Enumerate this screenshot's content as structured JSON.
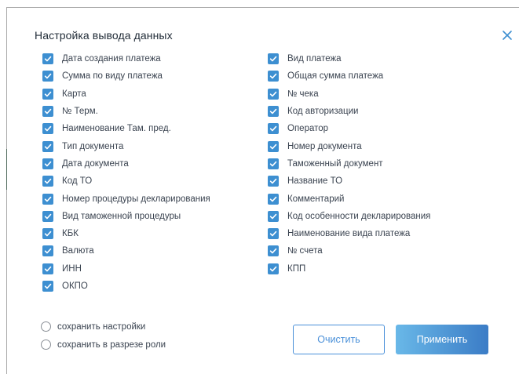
{
  "dialog": {
    "title": "Настройка вывода данных"
  },
  "colors": {
    "checkbox": "#3d8fd1",
    "accent": "#4a90d9",
    "apply_gradient_start": "#69b8e8",
    "apply_gradient_end": "#3b7cc6"
  },
  "left_options": [
    {
      "label": "Дата создания платежа",
      "checked": true
    },
    {
      "label": "Сумма по виду платежа",
      "checked": true
    },
    {
      "label": "Карта",
      "checked": true
    },
    {
      "label": "№ Терм.",
      "checked": true
    },
    {
      "label": "Наименование Там. пред.",
      "checked": true
    },
    {
      "label": "Тип документа",
      "checked": true
    },
    {
      "label": "Дата документа",
      "checked": true
    },
    {
      "label": "Код ТО",
      "checked": true
    },
    {
      "label": "Номер процедуры декларирования",
      "checked": true
    },
    {
      "label": "Вид таможенной процедуры",
      "checked": true
    },
    {
      "label": "КБК",
      "checked": true
    },
    {
      "label": "Валюта",
      "checked": true
    },
    {
      "label": "ИНН",
      "checked": true
    },
    {
      "label": "ОКПО",
      "checked": true
    }
  ],
  "right_options": [
    {
      "label": "Вид платежа",
      "checked": true
    },
    {
      "label": "Общая сумма платежа",
      "checked": true
    },
    {
      "label": "№ чека",
      "checked": true
    },
    {
      "label": "Код авторизации",
      "checked": true
    },
    {
      "label": "Оператор",
      "checked": true
    },
    {
      "label": "Номер документа",
      "checked": true
    },
    {
      "label": "Таможенный документ",
      "checked": true
    },
    {
      "label": "Название ТО",
      "checked": true
    },
    {
      "label": "Комментарий",
      "checked": true
    },
    {
      "label": "Код особенности декларирования",
      "checked": true
    },
    {
      "label": "Наименование вида платежа",
      "checked": true
    },
    {
      "label": "№ счета",
      "checked": true
    },
    {
      "label": "КПП",
      "checked": true
    }
  ],
  "radios": {
    "save_settings": "сохранить настройки",
    "save_by_role": "сохранить в разрезе роли"
  },
  "buttons": {
    "clear": "Очистить",
    "apply": "Применить"
  },
  "icons": {
    "close": "close-icon",
    "check": "checkmark-icon"
  }
}
